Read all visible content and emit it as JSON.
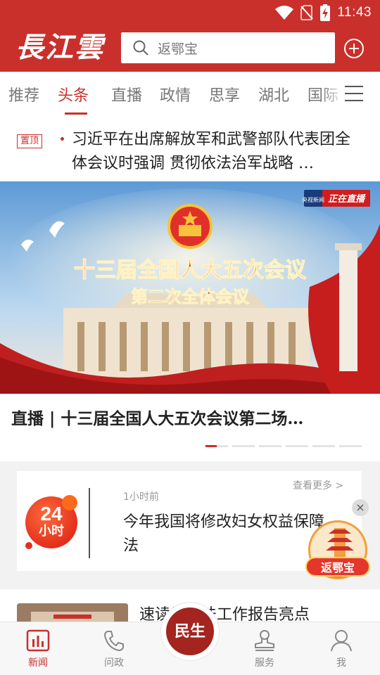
{
  "status_bar": {
    "time": "11:43"
  },
  "header": {
    "logo_text": "長江雲",
    "search_placeholder": "返鄂宝",
    "accent_color": "#c9302c"
  },
  "tabs": [
    {
      "label": "推荐"
    },
    {
      "label": "头条",
      "active": true
    },
    {
      "label": "直播"
    },
    {
      "label": "政情"
    },
    {
      "label": "思享"
    },
    {
      "label": "湖北"
    },
    {
      "label": "国际"
    }
  ],
  "pinned": {
    "badge": "置顶",
    "headline": "习近平在出席解放军和武警部队代表团全体会议时强调 贯彻依法治军战略 …"
  },
  "banner": {
    "corner_logo_top": "央视新闻",
    "corner_logo_main": "正在直播",
    "title_line1": "十三届全国人大五次会议",
    "title_line2": "第二次全体会议",
    "caption": "直播 | 十三届全国人大五次会议第二场…",
    "page_count": 7,
    "current_page": 1
  },
  "news24": {
    "badge_number": "24",
    "badge_unit": "小时",
    "more_link": "查看更多 >",
    "time_ago": "1小时前",
    "headline": "今年我国将修改妇女权益保障法"
  },
  "promo": {
    "label": "返鄂宝",
    "close_icon": "×"
  },
  "article2": {
    "title": "速读最高法工作报告亮点"
  },
  "bottom_nav": {
    "items": [
      {
        "label": "新闻",
        "icon": "news-chart-icon",
        "active": true
      },
      {
        "label": "问政",
        "icon": "phone-icon"
      },
      {
        "label": "服务",
        "icon": "stamp-icon"
      },
      {
        "label": "我",
        "icon": "person-icon"
      }
    ],
    "center_label": "民生"
  }
}
